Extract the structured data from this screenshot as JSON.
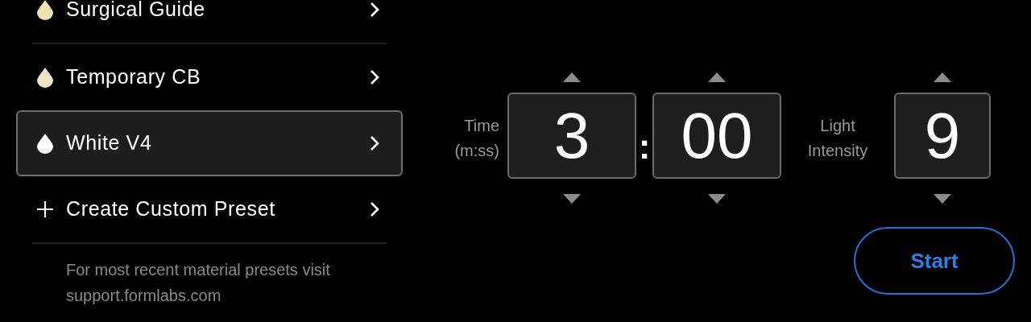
{
  "presets": [
    {
      "kind": "material",
      "label": "Surgical Guide",
      "color": "#f0e4ad",
      "selected": false
    },
    {
      "kind": "material",
      "label": "Temporary CB",
      "color": "#ece5c6",
      "selected": false
    },
    {
      "kind": "material",
      "label": "White V4",
      "color": "#ffffff",
      "selected": true
    },
    {
      "kind": "add",
      "label": "Create Custom Preset",
      "selected": false
    }
  ],
  "footer_note": "For most recent material presets visit support.formlabs.com",
  "time": {
    "label": "Time (m:ss)",
    "minutes": "3",
    "separator": ":",
    "seconds": "00"
  },
  "light_intensity": {
    "label": "Light Intensity",
    "value": "9"
  },
  "start_button": "Start"
}
